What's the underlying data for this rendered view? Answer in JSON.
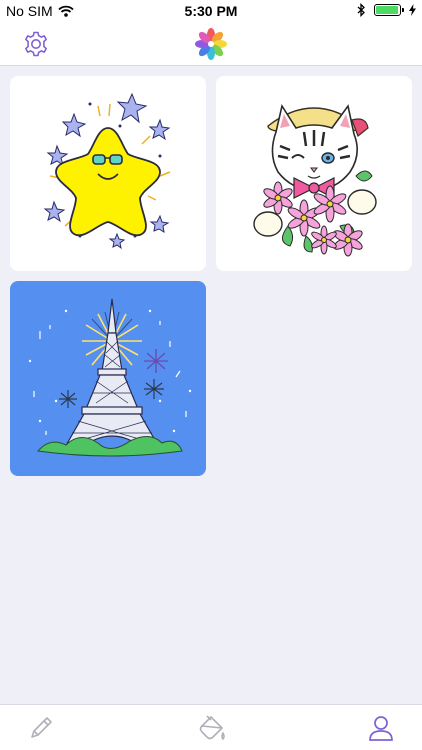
{
  "status_bar": {
    "carrier": "No SIM",
    "time": "5:30 PM",
    "battery_level": 0.95
  },
  "nav": {
    "left_icon": "gear-icon",
    "center_icon": "color-petals-logo"
  },
  "gallery": {
    "items": [
      {
        "subject": "star-with-sunglasses",
        "background": "#ffffff"
      },
      {
        "subject": "kitten-with-flowers",
        "background": "#ffffff"
      },
      {
        "subject": "eiffel-tower-fireworks",
        "background": "#5590f0"
      }
    ]
  },
  "tab_bar": {
    "tabs": [
      {
        "icon": "pencil-icon",
        "active": false
      },
      {
        "icon": "paint-bucket-icon",
        "active": false
      },
      {
        "icon": "profile-icon",
        "active": true
      }
    ],
    "active_color": "#7e63d6",
    "inactive_color": "#b0b0b8"
  },
  "colors": {
    "accent": "#7e63d6",
    "background": "#efeff8"
  }
}
